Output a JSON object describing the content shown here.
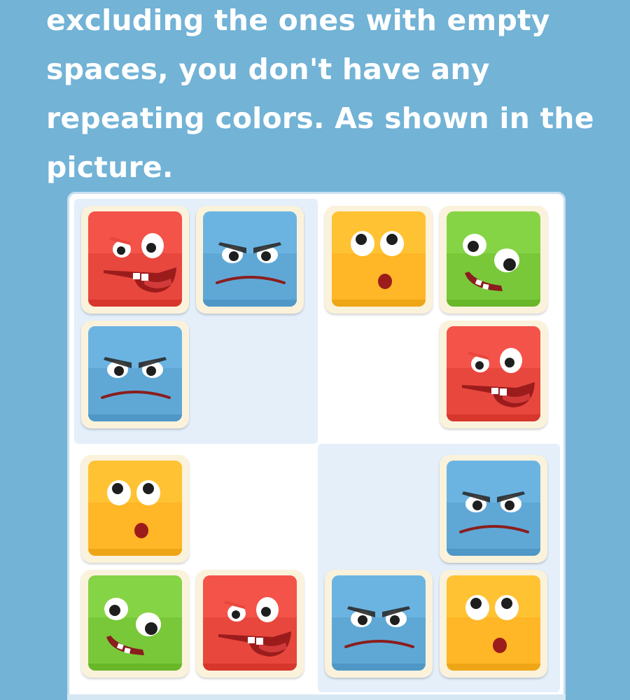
{
  "instructions": {
    "line1": "excluding the ones with empty",
    "line2": "spaces, you don't have any",
    "line3": "repeating colors. As shown in the",
    "line4": "picture."
  },
  "colors": {
    "background": "#72b3d6",
    "red": "#e8473d",
    "blue": "#5fa8d6",
    "yellow": "#ffb627",
    "green": "#79c83a",
    "tile_border": "#fbf2dc",
    "quadrant_shade": "#e4effa"
  },
  "board": {
    "grid": [
      [
        "red",
        "blue",
        "yellow",
        "green"
      ],
      [
        "blue",
        "",
        "",
        "red"
      ],
      [
        "yellow",
        "",
        "",
        "blue"
      ],
      [
        "green",
        "red",
        "blue",
        "yellow"
      ]
    ],
    "faces": {
      "red": "red-grin-face-icon",
      "blue": "blue-angry-face-icon",
      "yellow": "yellow-surprised-face-icon",
      "green": "green-smile-face-icon"
    }
  }
}
